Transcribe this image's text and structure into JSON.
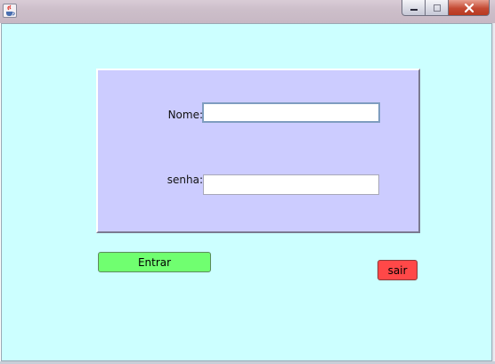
{
  "window": {
    "title": "",
    "icon": "java-cup-icon",
    "controls": [
      "minimize",
      "maximize",
      "close"
    ]
  },
  "colors": {
    "client_background": "#ccffff",
    "panel_background": "#ccccff",
    "entrar_button": "#70ff70",
    "sair_button": "#ff4848"
  },
  "form": {
    "nome_label": "Nome:",
    "nome_value": "",
    "senha_label": "senha:",
    "senha_value": ""
  },
  "actions": {
    "entrar_label": "Entrar",
    "sair_label": "sair"
  }
}
